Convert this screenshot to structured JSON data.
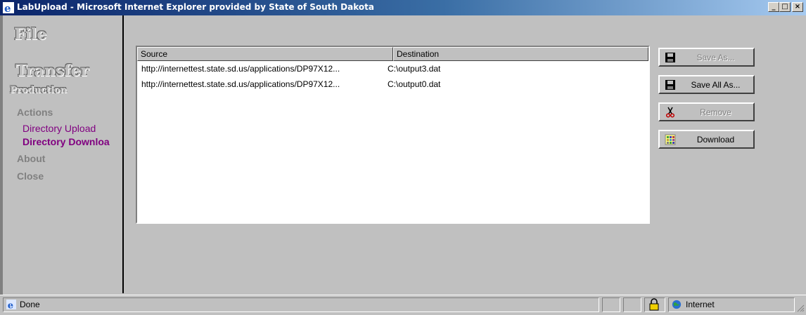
{
  "window": {
    "title": "LabUpload - Microsoft Internet Explorer provided by State of South Dakota",
    "minimize": "_",
    "maximize": "□",
    "close": "×"
  },
  "sidebar": {
    "brand_line1": "File",
    "brand_line2": "Transfer",
    "brand_line3": "Production",
    "actions_heading": "Actions",
    "links": [
      {
        "label": "Directory Upload"
      },
      {
        "label": "Directory Downloa"
      }
    ],
    "about": "About",
    "close": "Close"
  },
  "transfers": {
    "columns": [
      "Source",
      "Destination"
    ],
    "rows": [
      {
        "source": "http://internettest.state.sd.us/applications/DP97X12...",
        "destination": "C:\\output3.dat"
      },
      {
        "source": "http://internettest.state.sd.us/applications/DP97X12...",
        "destination": "C:\\output0.dat"
      }
    ]
  },
  "actions": {
    "save_as": "Save As...",
    "save_all_as": "Save All As...",
    "remove": "Remove",
    "download": "Download"
  },
  "status": {
    "text": "Done",
    "zone": "Internet"
  },
  "colors": {
    "title_gradient_start": "#0a246a",
    "link_visited": "#800080",
    "nav_disabled": "#808080",
    "face": "#c0c0c0"
  }
}
